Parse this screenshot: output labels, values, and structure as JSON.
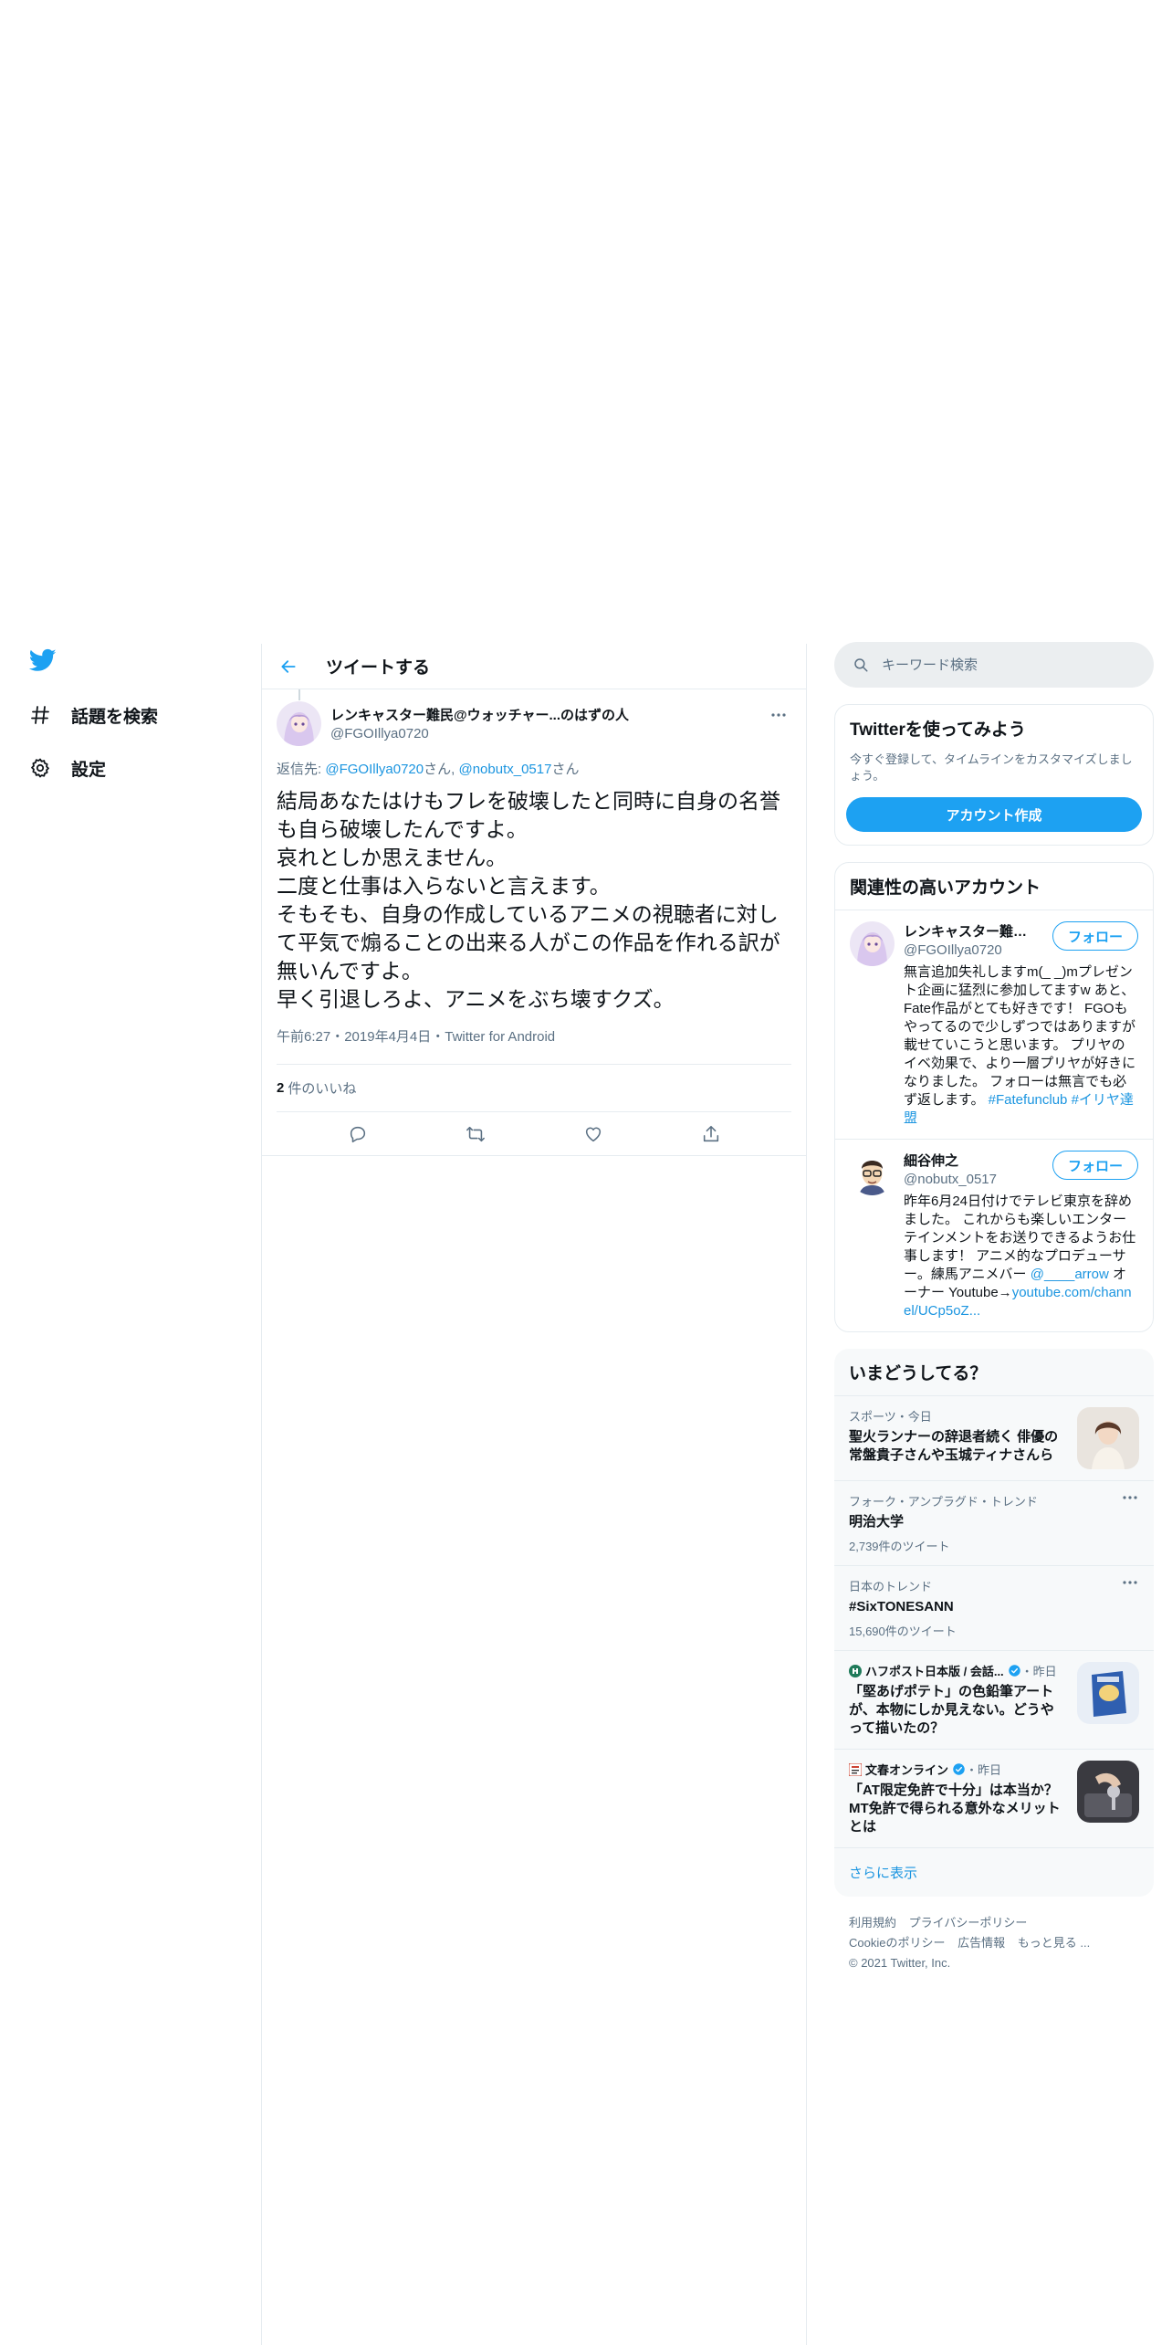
{
  "nav": {
    "logo": "twitter-bird-icon",
    "items": [
      {
        "label": "話題を検索",
        "icon": "hashtag-icon"
      },
      {
        "label": "設定",
        "icon": "gear-icon"
      }
    ]
  },
  "main": {
    "title": "ツイートする",
    "tweet": {
      "author_name": "レンキャスター難民@ウォッチャー...のはずの人",
      "author_handle": "@FGOIllya0720",
      "reply_prefix": "返信先: ",
      "reply_user1": "@FGOIllya0720",
      "reply_san1": "さん, ",
      "reply_user2": "@nobutx_0517",
      "reply_san2": "さん",
      "text": "結局あなたはけもフレを破壊したと同時に自身の名誉も自ら破壊したんですよ。\n哀れとしか思えません。\n二度と仕事は入らないと言えます。\nそもそも、自身の作成しているアニメの視聴者に対して平気で煽ることの出来る人がこの作品を作れる訳が無いんですよ。\n早く引退しろよ、アニメをぶち壊すクズ。",
      "meta": "午前6:27・2019年4月4日・Twitter for Android",
      "likes_count": "2",
      "likes_label": "件のいいね"
    }
  },
  "right": {
    "search_placeholder": "キーワード検索",
    "signup": {
      "title": "Twitterを使ってみよう",
      "desc": "今すぐ登録して、タイムラインをカスタマイズしましょう。",
      "button": "アカウント作成"
    },
    "relevant": {
      "title": "関連性の高いアカウント",
      "follow_label": "フォロー",
      "accounts": [
        {
          "name": "レンキャスター難民@...",
          "handle": "@FGOIllya0720",
          "bio": "無言追加失礼しますm(_ _)mプレゼント企画に猛烈に参加してますw あと、Fate作品がとても好きです！ FGOもやってるので少しずつではありますが載せていこうと思います。 プリヤのイベ効果で、より一層プリヤが好きになりました。 フォローは無言でも必ず返します。 ",
          "bio_links": "#Fatefunclub #イリヤ達盟"
        },
        {
          "name": "細谷伸之",
          "handle": "@nobutx_0517",
          "bio": "昨年6月24日付けでテレビ東京を辞めました。 これからも楽しいエンターテインメントをお送りできるようお仕事します！ アニメ的なプロデューサー。練馬アニメバー ",
          "bio_link1": "@____arrow",
          "bio_mid": " オーナー Youtube→",
          "bio_link2": "youtube.com/channel/UCp5oZ..."
        }
      ]
    },
    "trends": {
      "title": "いまどうしてる？",
      "items": [
        {
          "meta": "スポーツ・今日",
          "title": "聖火ランナーの辞退者続く 俳優の常盤貴子さんや玉城ティナさんら"
        },
        {
          "meta": "フォーク・アンプラグド・トレンド",
          "title": "明治大学",
          "count": "2,739件のツイート"
        },
        {
          "meta": "日本のトレンド",
          "title": "#SixTONESANN",
          "count": "15,690件のツイート"
        },
        {
          "source": "ハフポスト日本版 / 会話...",
          "time": "・昨日",
          "title": "「堅あげポテト」の色鉛筆アートが、本物にしか見えない。どうやって描いたの？"
        },
        {
          "source": "文春オンライン",
          "time": "・昨日",
          "title": "「AT限定免許で十分」は本当か？　MT免許で得られる意外なメリットとは"
        }
      ],
      "show_more": "さらに表示"
    },
    "footer": {
      "terms": "利用規約",
      "privacy": "プライバシーポリシー",
      "cookie": "Cookieのポリシー",
      "ads": "広告情報",
      "more": "もっと見る ...",
      "copyright": "© 2021 Twitter, Inc."
    }
  },
  "colors": {
    "accent": "#1da1f2",
    "link": "#1b95e0",
    "secondary_text": "#5b7083",
    "border": "#e6ecf0"
  }
}
